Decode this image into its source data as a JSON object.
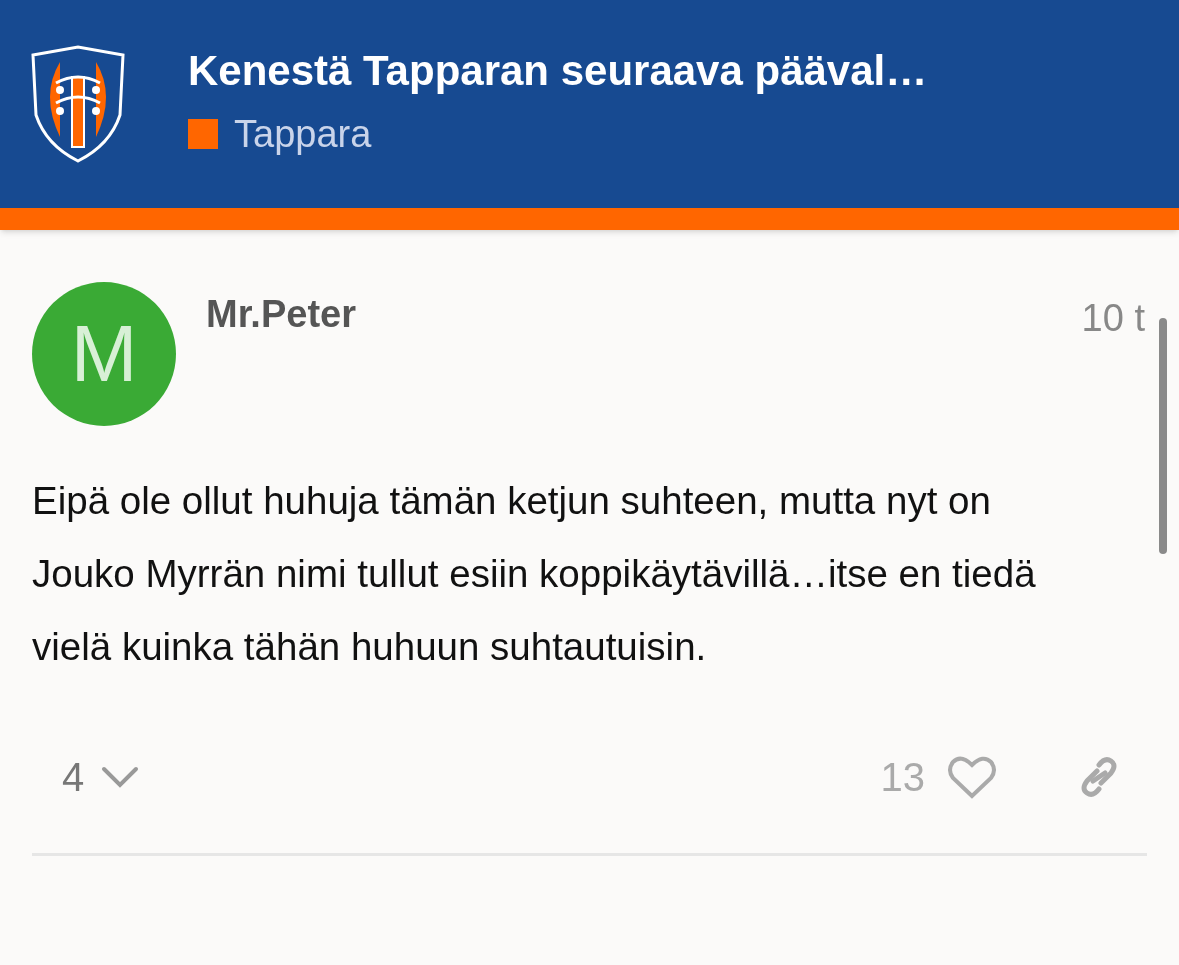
{
  "header": {
    "title": "Kenestä Tapparan seuraava pääval…",
    "category": {
      "name": "Tappara",
      "color": "#ff6600"
    }
  },
  "post": {
    "avatar_letter": "M",
    "author": "Mr.Peter",
    "age": "10 t",
    "body": "Eipä ole ollut huhuja tämän ketjun suhteen, mutta nyt on Jouko Myrrän nimi tullut esiin koppikäytävillä…itse en tiedä vielä kuinka tähän huhuun suhtautuisin.",
    "replies": "4",
    "likes": "13",
    "liked": false
  }
}
